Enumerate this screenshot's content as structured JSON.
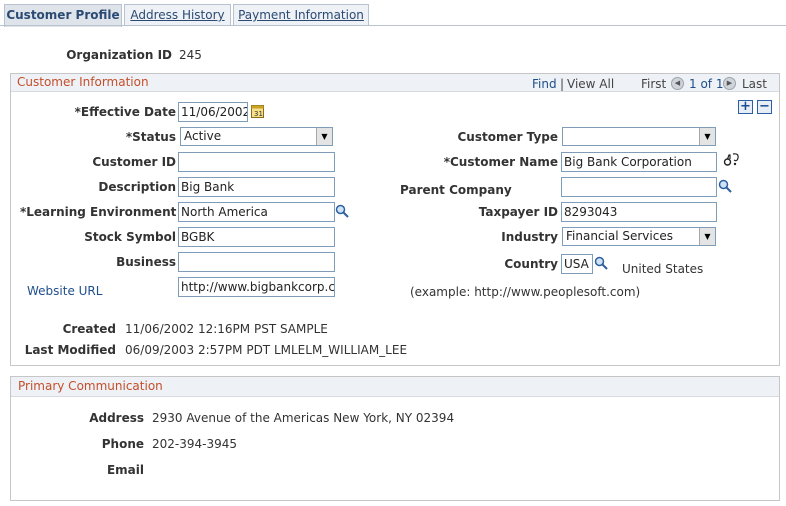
{
  "tabs": [
    {
      "label": "Customer Profile"
    },
    {
      "label": "Address History"
    },
    {
      "label": "Payment Information"
    }
  ],
  "header": {
    "org_id_label": "Organization ID",
    "org_id_value": "245"
  },
  "customer_info": {
    "title": "Customer Information",
    "find": "Find",
    "separator": "|",
    "view_all": "View All",
    "first": "First",
    "pager": "1 of 1",
    "last": "Last",
    "add": "+",
    "remove": "−",
    "fields": {
      "effective_date_label": "*Effective Date",
      "effective_date_value": "11/06/2002",
      "status_label": "*Status",
      "status_value": "Active",
      "customer_id_label": "Customer ID",
      "customer_id_value": "",
      "description_label": "Description",
      "description_value": "Big Bank",
      "learning_env_label": "*Learning Environment",
      "learning_env_value": "North America",
      "stock_symbol_label": "Stock Symbol",
      "stock_symbol_value": "BGBK",
      "business_label": "Business",
      "business_value": "",
      "website_label": "Website URL",
      "website_value": "http://www.bigbankcorp.com",
      "customer_type_label": "Customer Type",
      "customer_type_value": "",
      "customer_name_label": "*Customer Name",
      "customer_name_value": "Big Bank Corporation",
      "parent_company_label": "Parent Company",
      "parent_company_value": "",
      "taxpayer_id_label": "Taxpayer ID",
      "taxpayer_id_value": "8293043",
      "industry_label": "Industry",
      "industry_value": "Financial Services",
      "country_label": "Country",
      "country_value": "USA",
      "country_name": "United States",
      "url_example": "(example: http://www.peoplesoft.com)"
    },
    "created_label": "Created",
    "created_value": "11/06/2002 12:16PM PST  SAMPLE",
    "modified_label": "Last Modified",
    "modified_value": "06/09/2003  2:57PM PDT  LMLELM_WILLIAM_LEE"
  },
  "primary_comm": {
    "title": "Primary Communication",
    "address_label": "Address",
    "address_value": "2930 Avenue of the Americas New York, NY 02394",
    "phone_label": "Phone",
    "phone_value": "202-394-3945",
    "email_label": "Email",
    "email_value": ""
  },
  "colors": {
    "section_title": "#c44f2a",
    "link": "#1f4e8c",
    "tab_text": "#2b4a73"
  },
  "icons": [
    "calendar-icon",
    "magnifier-icon",
    "spell-check-icon",
    "add-row-icon",
    "delete-row-icon",
    "prev-arrow-icon",
    "next-arrow-icon"
  ]
}
